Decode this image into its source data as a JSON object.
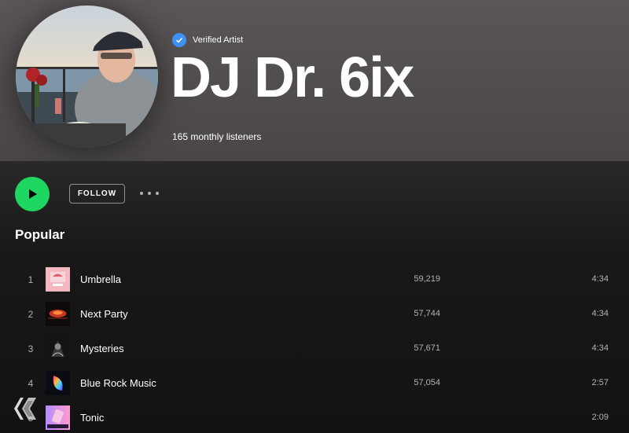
{
  "artist": {
    "verified_label": "Verified Artist",
    "name": "DJ Dr. 6ix",
    "monthly_listeners": "165 monthly listeners"
  },
  "actions": {
    "follow_label": "FOLLOW",
    "more_icon": "more-options-icon",
    "play_icon": "play-icon"
  },
  "popular": {
    "title": "Popular",
    "tracks": [
      {
        "num": "1",
        "title": "Umbrella",
        "plays": "59,219",
        "duration": "4:34"
      },
      {
        "num": "2",
        "title": "Next Party",
        "plays": "57,744",
        "duration": "4:34"
      },
      {
        "num": "3",
        "title": "Mysteries",
        "plays": "57,671",
        "duration": "4:34"
      },
      {
        "num": "4",
        "title": "Blue Rock Music",
        "plays": "57,054",
        "duration": "2:57"
      },
      {
        "num": "5",
        "title": "Tonic",
        "plays": "",
        "duration": "2:09"
      }
    ]
  },
  "colors": {
    "accent": "#1ed760",
    "verified_badge": "#3d91f4",
    "background": "#121212"
  }
}
